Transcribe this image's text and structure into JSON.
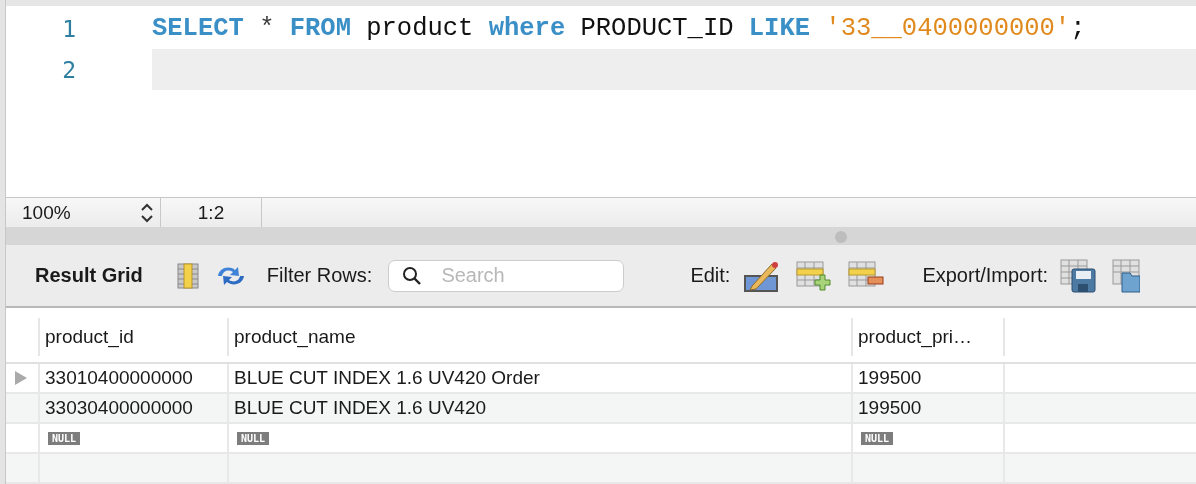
{
  "editor": {
    "lines": [
      {
        "number": "1",
        "current": false,
        "tokens": [
          {
            "kind": "keyword",
            "text": "SELECT"
          },
          {
            "kind": "operator",
            "text": "*"
          },
          {
            "kind": "keyword",
            "text": "FROM"
          },
          {
            "kind": "identifier",
            "text": "product"
          },
          {
            "kind": "keyword",
            "text": "where"
          },
          {
            "kind": "identifier",
            "text": "PRODUCT_ID"
          },
          {
            "kind": "keyword",
            "text": "LIKE"
          },
          {
            "kind": "string",
            "text": "'33__0400000000'"
          },
          {
            "kind": "punct",
            "text": ";"
          }
        ]
      },
      {
        "number": "2",
        "current": true
      }
    ]
  },
  "status_bar": {
    "zoom": "100%",
    "position": "1:2"
  },
  "toolbar": {
    "title": "Result Grid",
    "filter_label": "Filter Rows:",
    "search": {
      "placeholder": "Search"
    },
    "edit_label": "Edit:",
    "export_label": "Export/Import:"
  },
  "table": {
    "columns": [
      "product_id",
      "product_name",
      "product_pri…"
    ],
    "rows": [
      {
        "current": true,
        "cells": [
          {
            "kind": "value",
            "text": "33010400000000"
          },
          {
            "kind": "value",
            "text": "BLUE CUT INDEX 1.6 UV420 Order"
          },
          {
            "kind": "value",
            "text": "199500"
          }
        ]
      },
      {
        "current": false,
        "cells": [
          {
            "kind": "value",
            "text": "33030400000000"
          },
          {
            "kind": "value",
            "text": "BLUE CUT INDEX 1.6 UV420"
          },
          {
            "kind": "value",
            "text": "199500"
          }
        ]
      },
      {
        "current": false,
        "cells": [
          {
            "kind": "null",
            "text": "NULL"
          },
          {
            "kind": "null",
            "text": "NULL"
          },
          {
            "kind": "null",
            "text": "NULL"
          }
        ]
      }
    ]
  }
}
